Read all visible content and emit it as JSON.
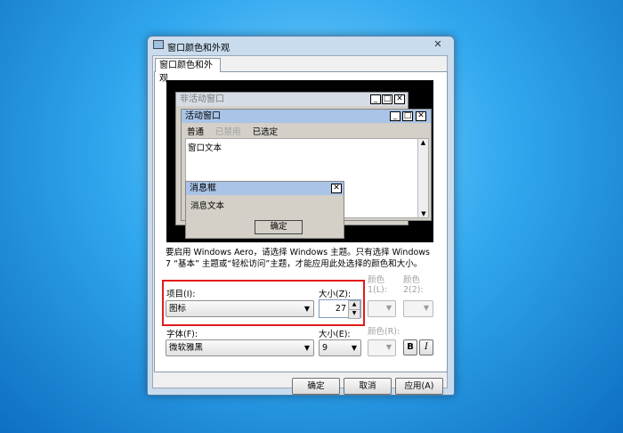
{
  "window": {
    "title": "窗口颜色和外观",
    "close_glyph": "✕"
  },
  "tab": {
    "label": "窗口颜色和外观"
  },
  "preview": {
    "inactive_title": "非活动窗口",
    "active_title": "活动窗口",
    "menu": {
      "normal": "普通",
      "disabled": "已禁用",
      "selected": "已选定"
    },
    "window_text": "窗口文本",
    "msgbox_title": "消息框",
    "msgbox_text": "消息文本",
    "msgbox_ok": "确定",
    "minimize_glyph": "_",
    "maximize_glyph": "□",
    "close_glyph": "✕"
  },
  "description": "要启用 Windows Aero，请选择 Windows 主题。只有选择 Windows 7 “基本” 主题或“轻松访问”主题，才能应用此处选择的颜色和大小。",
  "item": {
    "label": "项目(I):",
    "value": "图标"
  },
  "size": {
    "label": "大小(Z):",
    "value": "27"
  },
  "color1": {
    "label_top": "颜色",
    "label_bottom": "1(L):"
  },
  "color2": {
    "label_top": "颜色",
    "label_bottom": "2(2):"
  },
  "font": {
    "label": "字体(F):",
    "value": "微软雅黑"
  },
  "font_size": {
    "label": "大小(E):",
    "value": "9"
  },
  "font_color": {
    "label": "颜色(R):"
  },
  "bold": {
    "label": "B"
  },
  "italic": {
    "label": "I"
  },
  "buttons": {
    "ok": "确定",
    "cancel": "取消",
    "apply": "应用(A)"
  },
  "colors": {
    "highlight_box": "#e01b1b",
    "active_title": "#a9c4e6",
    "inactive_title": "#d6dce5"
  }
}
